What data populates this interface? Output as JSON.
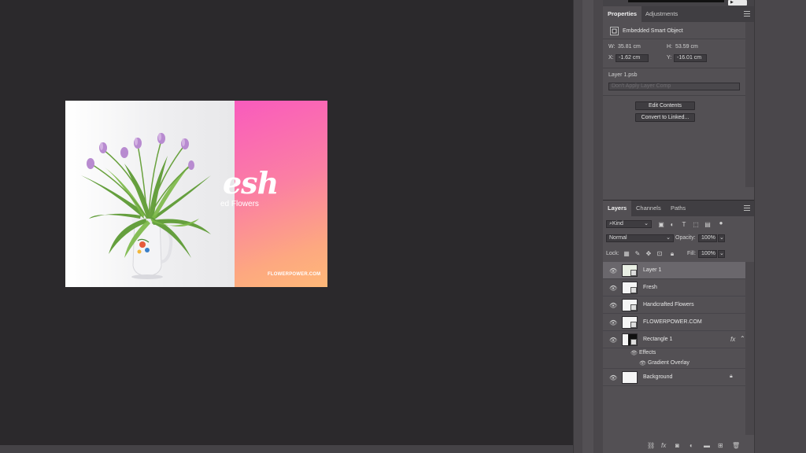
{
  "document": {
    "headline": "esh",
    "subline": "ed Flowers",
    "url": "FLOWERPOWER.COM"
  },
  "top_strip": {
    "button_glyph": "▶"
  },
  "properties": {
    "tabs": [
      "Properties",
      "Adjustments"
    ],
    "object_type": "Embedded Smart Object",
    "w_label": "W:",
    "w_value": "35.81 cm",
    "h_label": "H:",
    "h_value": "53.59 cm",
    "x_label": "X:",
    "x_value": "-1.62 cm",
    "y_label": "Y:",
    "y_value": "-16.01 cm",
    "file_name": "Layer 1.psb",
    "layer_comp": "Don't Apply Layer Comp",
    "edit_contents": "Edit Contents",
    "convert_linked": "Convert to Linked..."
  },
  "layers": {
    "tabs": [
      "Layers",
      "Channels",
      "Paths"
    ],
    "filter_kind": "Kind",
    "blend_mode": "Normal",
    "opacity_label": "Opacity:",
    "opacity_value": "100%",
    "lock_label": "Lock:",
    "fill_label": "Fill:",
    "fill_value": "100%",
    "items": [
      {
        "name": "Layer 1",
        "selected": true
      },
      {
        "name": "Fresh"
      },
      {
        "name": "Handcrafted Flowers"
      },
      {
        "name": "FLOWERPOWER.COM"
      },
      {
        "name": "Rectangle 1",
        "fx": "fx"
      },
      {
        "name": "Background"
      }
    ],
    "effects_label": "Effects",
    "effect_item": "Gradient Overlay"
  },
  "colors": {
    "panel_bg": "#535054",
    "canvas_bg": "#2b292c",
    "gradient_start": "#f95bbd",
    "gradient_end": "#feb878",
    "selected_row": "#6a676c"
  }
}
